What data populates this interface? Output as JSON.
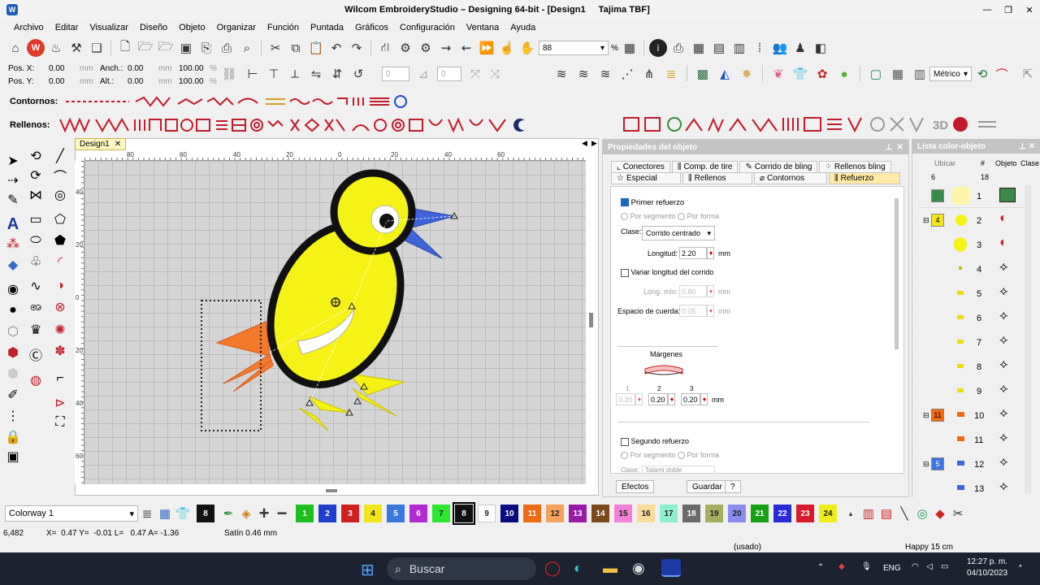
{
  "window": {
    "title": "Wilcom EmbroideryStudio – Designing 64-bit - [Design1",
    "machine": "Tajima TBF]",
    "minimize": "—",
    "restore": "❐",
    "close": "✕"
  },
  "menu": [
    "Archivo",
    "Editar",
    "Visualizar",
    "Diseño",
    "Objeto",
    "Organizar",
    "Función",
    "Puntada",
    "Gráficos",
    "Configuración",
    "Ventana",
    "Ayuda"
  ],
  "toolbar": {
    "zoom_value": "88",
    "zoom_unit": "%",
    "units_value": "Métrico"
  },
  "position": {
    "pos_x_label": "Pos. X:",
    "pos_x_value": "0.00",
    "pos_x_unit": "mm",
    "pos_y_label": "Pos. Y:",
    "pos_y_value": "0.00",
    "pos_y_unit": "mm",
    "width_label": "Anch.:",
    "width_value": "0.00",
    "width_unit": "mm",
    "width_pct": "100.00",
    "width_pct_unit": "%",
    "height_label": "Alt.:",
    "height_value": "0.00",
    "height_unit": "mm",
    "height_pct": "100.00",
    "height_pct_unit": "%",
    "rotate_value": "0",
    "slant_value": "0"
  },
  "strips": {
    "outlines_label": "Contornos:",
    "fills_label": "Rellenos:"
  },
  "document": {
    "tab_label": "Design1",
    "ruler_top": [
      "80",
      "60",
      "40",
      "20",
      "0",
      "20",
      "40",
      "60"
    ],
    "ruler_left": [
      "40",
      "20",
      "0",
      "20",
      "40",
      "60"
    ]
  },
  "properties": {
    "title": "Propiedades del objeto",
    "tabs_row1": [
      "Conectores",
      "Comp. de tire",
      "Corrido de bling",
      "Rellenos bling"
    ],
    "tabs_row2": [
      "Especial",
      "Rellenos",
      "Contornos",
      "Refuerzo"
    ],
    "first_underlay": "Primer refuerzo",
    "by_segment": "Por segmento",
    "by_shape": "Por forma",
    "class_label": "Clase:",
    "class_value": "Corrido centrado",
    "length_label": "Longitud:",
    "length_value": "2.20",
    "length_unit": "mm",
    "vary_length": "Variar longitud del corrido",
    "min_length_label": "Long. mín:",
    "min_length_value": "0.80",
    "min_length_unit": "mm",
    "string_spacing_label": "Espacio de cuerda:",
    "string_spacing_value": "0.05",
    "string_spacing_unit": "mm",
    "margins_label": "Márgenes",
    "margin_1_label": "1",
    "margin_2_label": "2",
    "margin_3_label": "3",
    "margin_1_value": "0.20",
    "margin_2_value": "0.20",
    "margin_3_value": "0.20",
    "margin_unit": "mm",
    "second_underlay": "Segundo refuerzo",
    "second_class_label": "Clase:",
    "second_class_value": "Tatami doble",
    "effects_button": "Efectos",
    "save_button": "Guardar",
    "help_button": "?"
  },
  "color_list": {
    "title": "Lista color-objeto",
    "header_count": "6",
    "header_locate": "Ubicar",
    "header_total": "18",
    "header_hash": "#",
    "header_object": "Objeto",
    "header_class": "Clase",
    "rows": [
      {
        "num": "1",
        "group": ""
      },
      {
        "num": "2",
        "group": "4"
      },
      {
        "num": "3",
        "group": ""
      },
      {
        "num": "4",
        "group": ""
      },
      {
        "num": "5",
        "group": ""
      },
      {
        "num": "6",
        "group": ""
      },
      {
        "num": "7",
        "group": ""
      },
      {
        "num": "8",
        "group": ""
      },
      {
        "num": "9",
        "group": ""
      },
      {
        "num": "10",
        "group": "11"
      },
      {
        "num": "11",
        "group": ""
      },
      {
        "num": "12",
        "group": "5"
      },
      {
        "num": "13",
        "group": ""
      }
    ]
  },
  "palette": {
    "colorway": "Colorway 1",
    "current": "8",
    "cells": [
      {
        "n": "1",
        "c": "#1fbf1f"
      },
      {
        "n": "2",
        "c": "#1f3fd0"
      },
      {
        "n": "3",
        "c": "#d01f1f"
      },
      {
        "n": "4",
        "c": "#f2e51c"
      },
      {
        "n": "5",
        "c": "#3a78e0"
      },
      {
        "n": "6",
        "c": "#b02ad0"
      },
      {
        "n": "7",
        "c": "#2ee82e"
      },
      {
        "n": "8",
        "c": "#111111"
      },
      {
        "n": "9",
        "c": "#ffffff"
      },
      {
        "n": "10",
        "c": "#0a0a80"
      },
      {
        "n": "11",
        "c": "#f06a12"
      },
      {
        "n": "12",
        "c": "#f5a25a"
      },
      {
        "n": "13",
        "c": "#9a1aa8"
      },
      {
        "n": "14",
        "c": "#7a4a1c"
      },
      {
        "n": "15",
        "c": "#f27fd8"
      },
      {
        "n": "16",
        "c": "#fadc9a"
      },
      {
        "n": "17",
        "c": "#8ef0d0"
      },
      {
        "n": "18",
        "c": "#6a6a6a"
      },
      {
        "n": "19",
        "c": "#a4b060"
      },
      {
        "n": "20",
        "c": "#8c8cf0"
      },
      {
        "n": "21",
        "c": "#16a016"
      },
      {
        "n": "22",
        "c": "#2a2ad8"
      },
      {
        "n": "23",
        "c": "#d81a2a"
      },
      {
        "n": "24",
        "c": "#f0ec1a"
      }
    ]
  },
  "status": {
    "stitches": "6,482",
    "coords": "X=  0.47 Y=  -0.01 L=   0.47 A= -1.36",
    "stitch_info": "Satín 0.46 mm",
    "used": "(usado)",
    "font": "Happy 15 cm"
  },
  "taskbar": {
    "search": "Buscar",
    "lang": "ENG",
    "time": "12:27 p. m.",
    "date": "04/10/2023"
  },
  "colors": {
    "accent_yellow": "#ffe9a6",
    "chick_yellow": "#f5f215",
    "beak_blue": "#3f63d8",
    "tail_orange": "#f27a2a"
  }
}
